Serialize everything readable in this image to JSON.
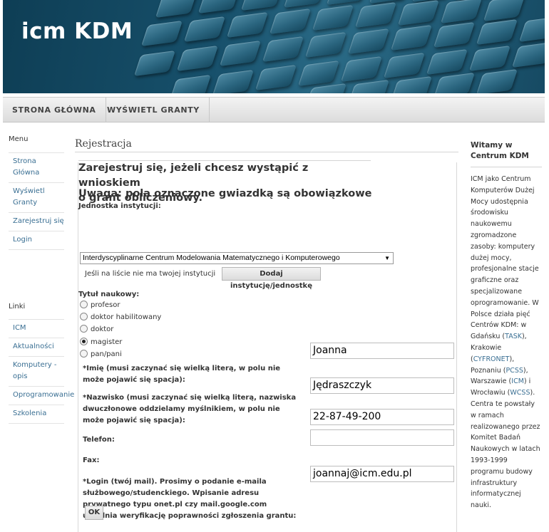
{
  "header": {
    "title": "icm KDM"
  },
  "nav": {
    "tabs": [
      "STRONA GŁÓWNA",
      "WYŚWIETL GRANTY"
    ]
  },
  "left_menu": {
    "heading": "Menu",
    "items": [
      "Strona Główna",
      "Wyświetl Granty",
      "Zarejestruj się",
      "Login"
    ]
  },
  "left_links": {
    "heading": "Linki",
    "items": [
      "ICM",
      "Aktualności",
      "Komputery - opis",
      "Oprogramowanie",
      "Szkolenia"
    ]
  },
  "main": {
    "page_title": "Rejestracja",
    "intro_line1": "Zarejestruj się, jeżeli chcesz wystąpić z wnioskiem",
    "intro_line2": "o grant obliczeniowy.",
    "intro_line3": "Uwaga: pola oznaczone gwiazdką są obowiązkowe",
    "unit_label": "Jednostka instytucji:",
    "unit_select_value": "Interdyscyplinarne Centrum Modelowania Matematycznego i Komputerowego",
    "unit_note": "Jeśli na liście nie ma twojej instytucji",
    "add_unit_button": "Dodaj instytucję/jednostkę",
    "title_label": "Tytuł naukowy:",
    "title_options": [
      "profesor",
      "doktor habilitowany",
      "doktor",
      "magister",
      "pan/pani"
    ],
    "title_selected": "magister",
    "first_name_label": "*Imię (musi zaczynać się wielką literą, w polu nie może pojawić się spacja):",
    "first_name_value": "Joanna",
    "last_name_label": "*Nazwisko (musi zaczynać się wielką literą, nazwiska dwuczłonowe oddzielamy myślnikiem, w polu nie może pojawić się spacja):",
    "last_name_value": "Jędraszczyk",
    "phone_label": "Telefon:",
    "phone_value": "22-87-49-200",
    "fax_label": "Fax:",
    "fax_value": "",
    "login_label": "*Login (twój mail). Prosimy o podanie e-maila służbowego/studenckiego. Wpisanie adresu prywatnego typu onet.pl czy mail.google.com utrudnia weryfikację poprawności zgłoszenia grantu:",
    "login_value": "joannaj@icm.edu.pl",
    "ok_button": "OK"
  },
  "right": {
    "title": "Witamy w Centrum KDM",
    "text_before": "ICM jako Centrum Komputerów Dużej Mocy udostępnia środowisku naukowemu zgromadzone zasoby: komputery dużej mocy, profesjonalne stacje graficzne oraz specjalizowane oprogramowanie. W Polsce działa pięć Centrów KDM: w Gdańsku (",
    "link1": "TASK",
    "text_mid1": "), Krakowie (",
    "link2": "CYFRONET",
    "text_mid2": "), Poznaniu (",
    "link3": "PCSS",
    "text_mid3": "), Warszawie (",
    "link4": "ICM",
    "text_mid4": ") i Wrocławiu (",
    "link5": "WCSS",
    "text_after": "). Centra te powstały w ramach realizowanego przez Komitet Badań Naukowych w latach 1993-1999 programu budowy infrastruktury informatycznej nauki."
  },
  "colors": {
    "header_bg": "#17506b",
    "link": "#3a6f93",
    "nav_bg": "#e6e6e6"
  }
}
